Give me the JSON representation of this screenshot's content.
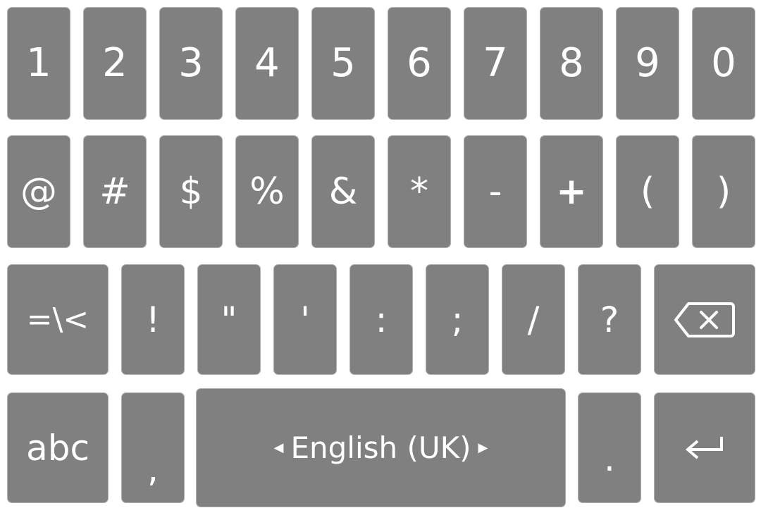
{
  "keyboard": {
    "row1": [
      "1",
      "2",
      "3",
      "4",
      "5",
      "6",
      "7",
      "8",
      "9",
      "0"
    ],
    "row2": [
      "@",
      "#",
      "$",
      "%",
      "&",
      "*",
      "-",
      "+",
      "(",
      ")"
    ],
    "row3": {
      "mode_label": "=\\<",
      "keys": [
        "!",
        "\"",
        "'",
        ":",
        ";",
        "/",
        "?"
      ],
      "backspace_icon": "backspace-icon"
    },
    "row4": {
      "mode_label": "abc",
      "comma": ",",
      "space_prev_arrow": "◀",
      "space_label": "English (UK)",
      "space_next_arrow": "▶",
      "period": ".",
      "enter_icon": "enter-icon"
    },
    "colors": {
      "key_bg": "#808080",
      "key_text": "#ffffff",
      "page_bg": "#ffffff"
    }
  }
}
